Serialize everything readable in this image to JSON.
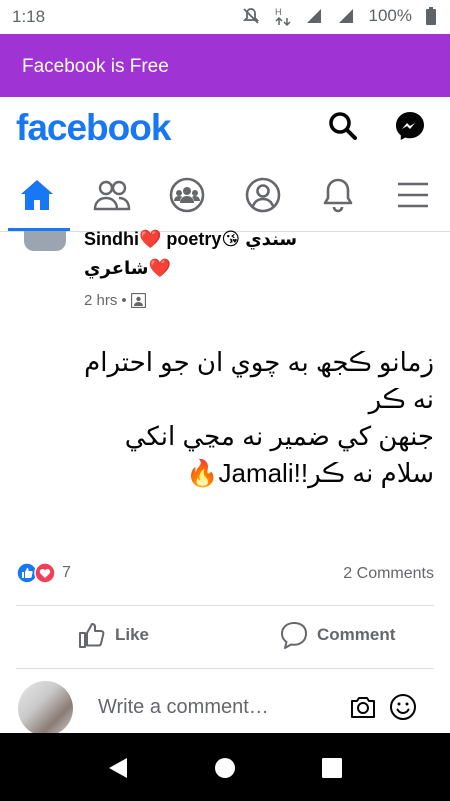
{
  "status_bar": {
    "time": "1:18",
    "battery": "100%"
  },
  "banner": {
    "text": "Facebook is Free",
    "color": "#a033d3"
  },
  "header": {
    "logo": "facebook",
    "accent": "#1877f2"
  },
  "tabs": [
    {
      "name": "home",
      "icon": "home-icon",
      "active": true
    },
    {
      "name": "friends",
      "icon": "friends-icon"
    },
    {
      "name": "groups",
      "icon": "groups-icon"
    },
    {
      "name": "profile",
      "icon": "profile-icon"
    },
    {
      "name": "notifications",
      "icon": "bell-icon"
    },
    {
      "name": "menu",
      "icon": "menu-icon"
    }
  ],
  "post": {
    "page_name_line1": "Sindhi❤️ poetry😘 سندي",
    "page_name_line2": "❤️شاعري",
    "time": "2 hrs",
    "body": [
      "زمانو ڪجھ به چوي ان جو احترام",
      "نه ڪر",
      "جنهن کي ضمير نه مڃي انکي",
      "🔥Jamali!!سلام نه ڪر"
    ],
    "reaction_count": "7",
    "comments_count": "2 Comments",
    "like_label": "Like",
    "comment_label": "Comment"
  },
  "comment_box": {
    "placeholder": "Write a comment…"
  }
}
